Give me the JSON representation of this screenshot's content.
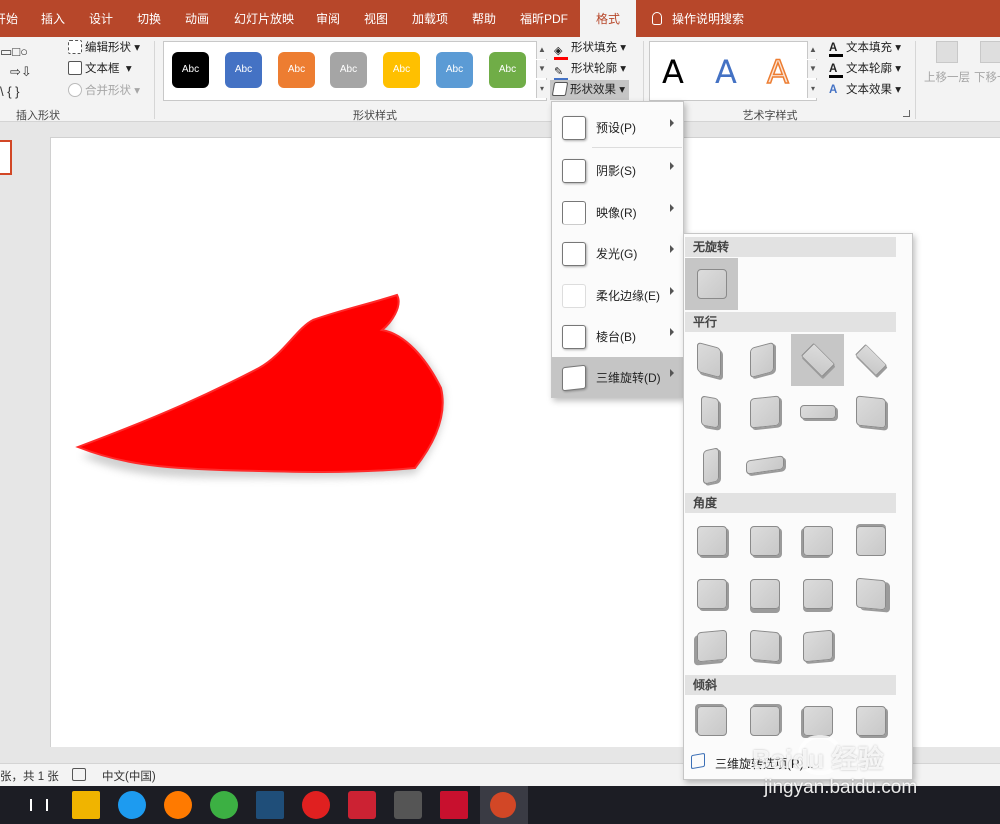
{
  "tabs": [
    "开始",
    "插入",
    "设计",
    "切换",
    "动画",
    "幻灯片放映",
    "审阅",
    "视图",
    "加载项",
    "帮助",
    "福昕PDF",
    "格式"
  ],
  "active_tab": "格式",
  "tell_me": "操作说明搜索",
  "ribbon": {
    "insert_shapes": {
      "edit_shape": "编辑形状",
      "text_box": "文本框",
      "merge_shapes": "合并形状",
      "label": "插入形状",
      "shape_row1": "▭□○",
      "shape_row2": "⇨⇩",
      "shape_row3": "\\ { }"
    },
    "shape_styles": {
      "label": "形状样式",
      "gallery": [
        {
          "text": "Abc",
          "color": "#000000"
        },
        {
          "text": "Abc",
          "color": "#4472c4"
        },
        {
          "text": "Abc",
          "color": "#ed7d31"
        },
        {
          "text": "Abc",
          "color": "#a5a5a5"
        },
        {
          "text": "Abc",
          "color": "#ffc000"
        },
        {
          "text": "Abc",
          "color": "#5b9bd5"
        },
        {
          "text": "Abc",
          "color": "#70ad47"
        }
      ],
      "fill": "形状填充",
      "outline": "形状轮廓",
      "effects": "形状效果"
    },
    "wordart_styles": {
      "label": "艺术字样式",
      "letters": [
        "A",
        "A",
        "A"
      ],
      "text_fill": "文本填充",
      "text_outline": "文本轮廓",
      "text_effects": "文本效果"
    },
    "arrange": {
      "bring_forward": "上移一层",
      "send_backward": "下移一"
    }
  },
  "effects_menu": {
    "items": [
      {
        "label": "预设(P)"
      },
      {
        "label": "阴影(S)"
      },
      {
        "label": "映像(R)"
      },
      {
        "label": "发光(G)"
      },
      {
        "label": "柔化边缘(E)"
      },
      {
        "label": "棱台(B)"
      },
      {
        "label": "三维旋转(D)"
      }
    ],
    "highlighted": "三维旋转(D)"
  },
  "rotation_menu": {
    "sections": {
      "none": "无旋转",
      "parallel": "平行",
      "perspective": "角度",
      "oblique": "倾斜"
    },
    "footer": "三维旋转选项(R)..."
  },
  "statusbar": {
    "slide_count": "张，共 1 张",
    "language": "中文(中国)"
  },
  "watermark": {
    "brand": "Baidu 经验",
    "url": "jingyan.baidu.com"
  },
  "colors": {
    "accent": "#b7472a",
    "shape_fill": "#ff0000"
  }
}
